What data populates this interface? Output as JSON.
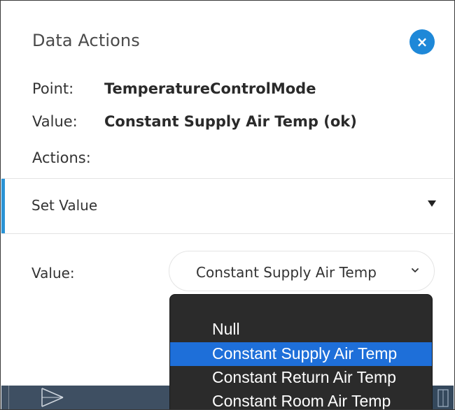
{
  "dialog": {
    "title": "Data Actions",
    "close_icon": "close-icon",
    "point_label": "Point:",
    "point_value": "TemperatureControlMode",
    "value_label": "Value:",
    "value_value": "Constant Supply Air Temp (ok)",
    "actions_label": "Actions:"
  },
  "action_section": {
    "header_label": "Set Value",
    "expand_icon": "caret-down-icon",
    "field_label": "Value:",
    "select_value": "Constant Supply Air Temp",
    "select_icon": "chevron-down-icon"
  },
  "dropdown": {
    "options": [
      "Null",
      "Constant Supply Air Temp",
      "Constant Return Air Temp",
      "Constant Room Air Temp"
    ],
    "selected": "Constant Supply Air Temp"
  },
  "colors": {
    "accent": "#2a93d5",
    "close_button": "#1e88d8",
    "dropdown_bg": "#2b2b2b",
    "dropdown_selected": "#1e6fd9"
  }
}
